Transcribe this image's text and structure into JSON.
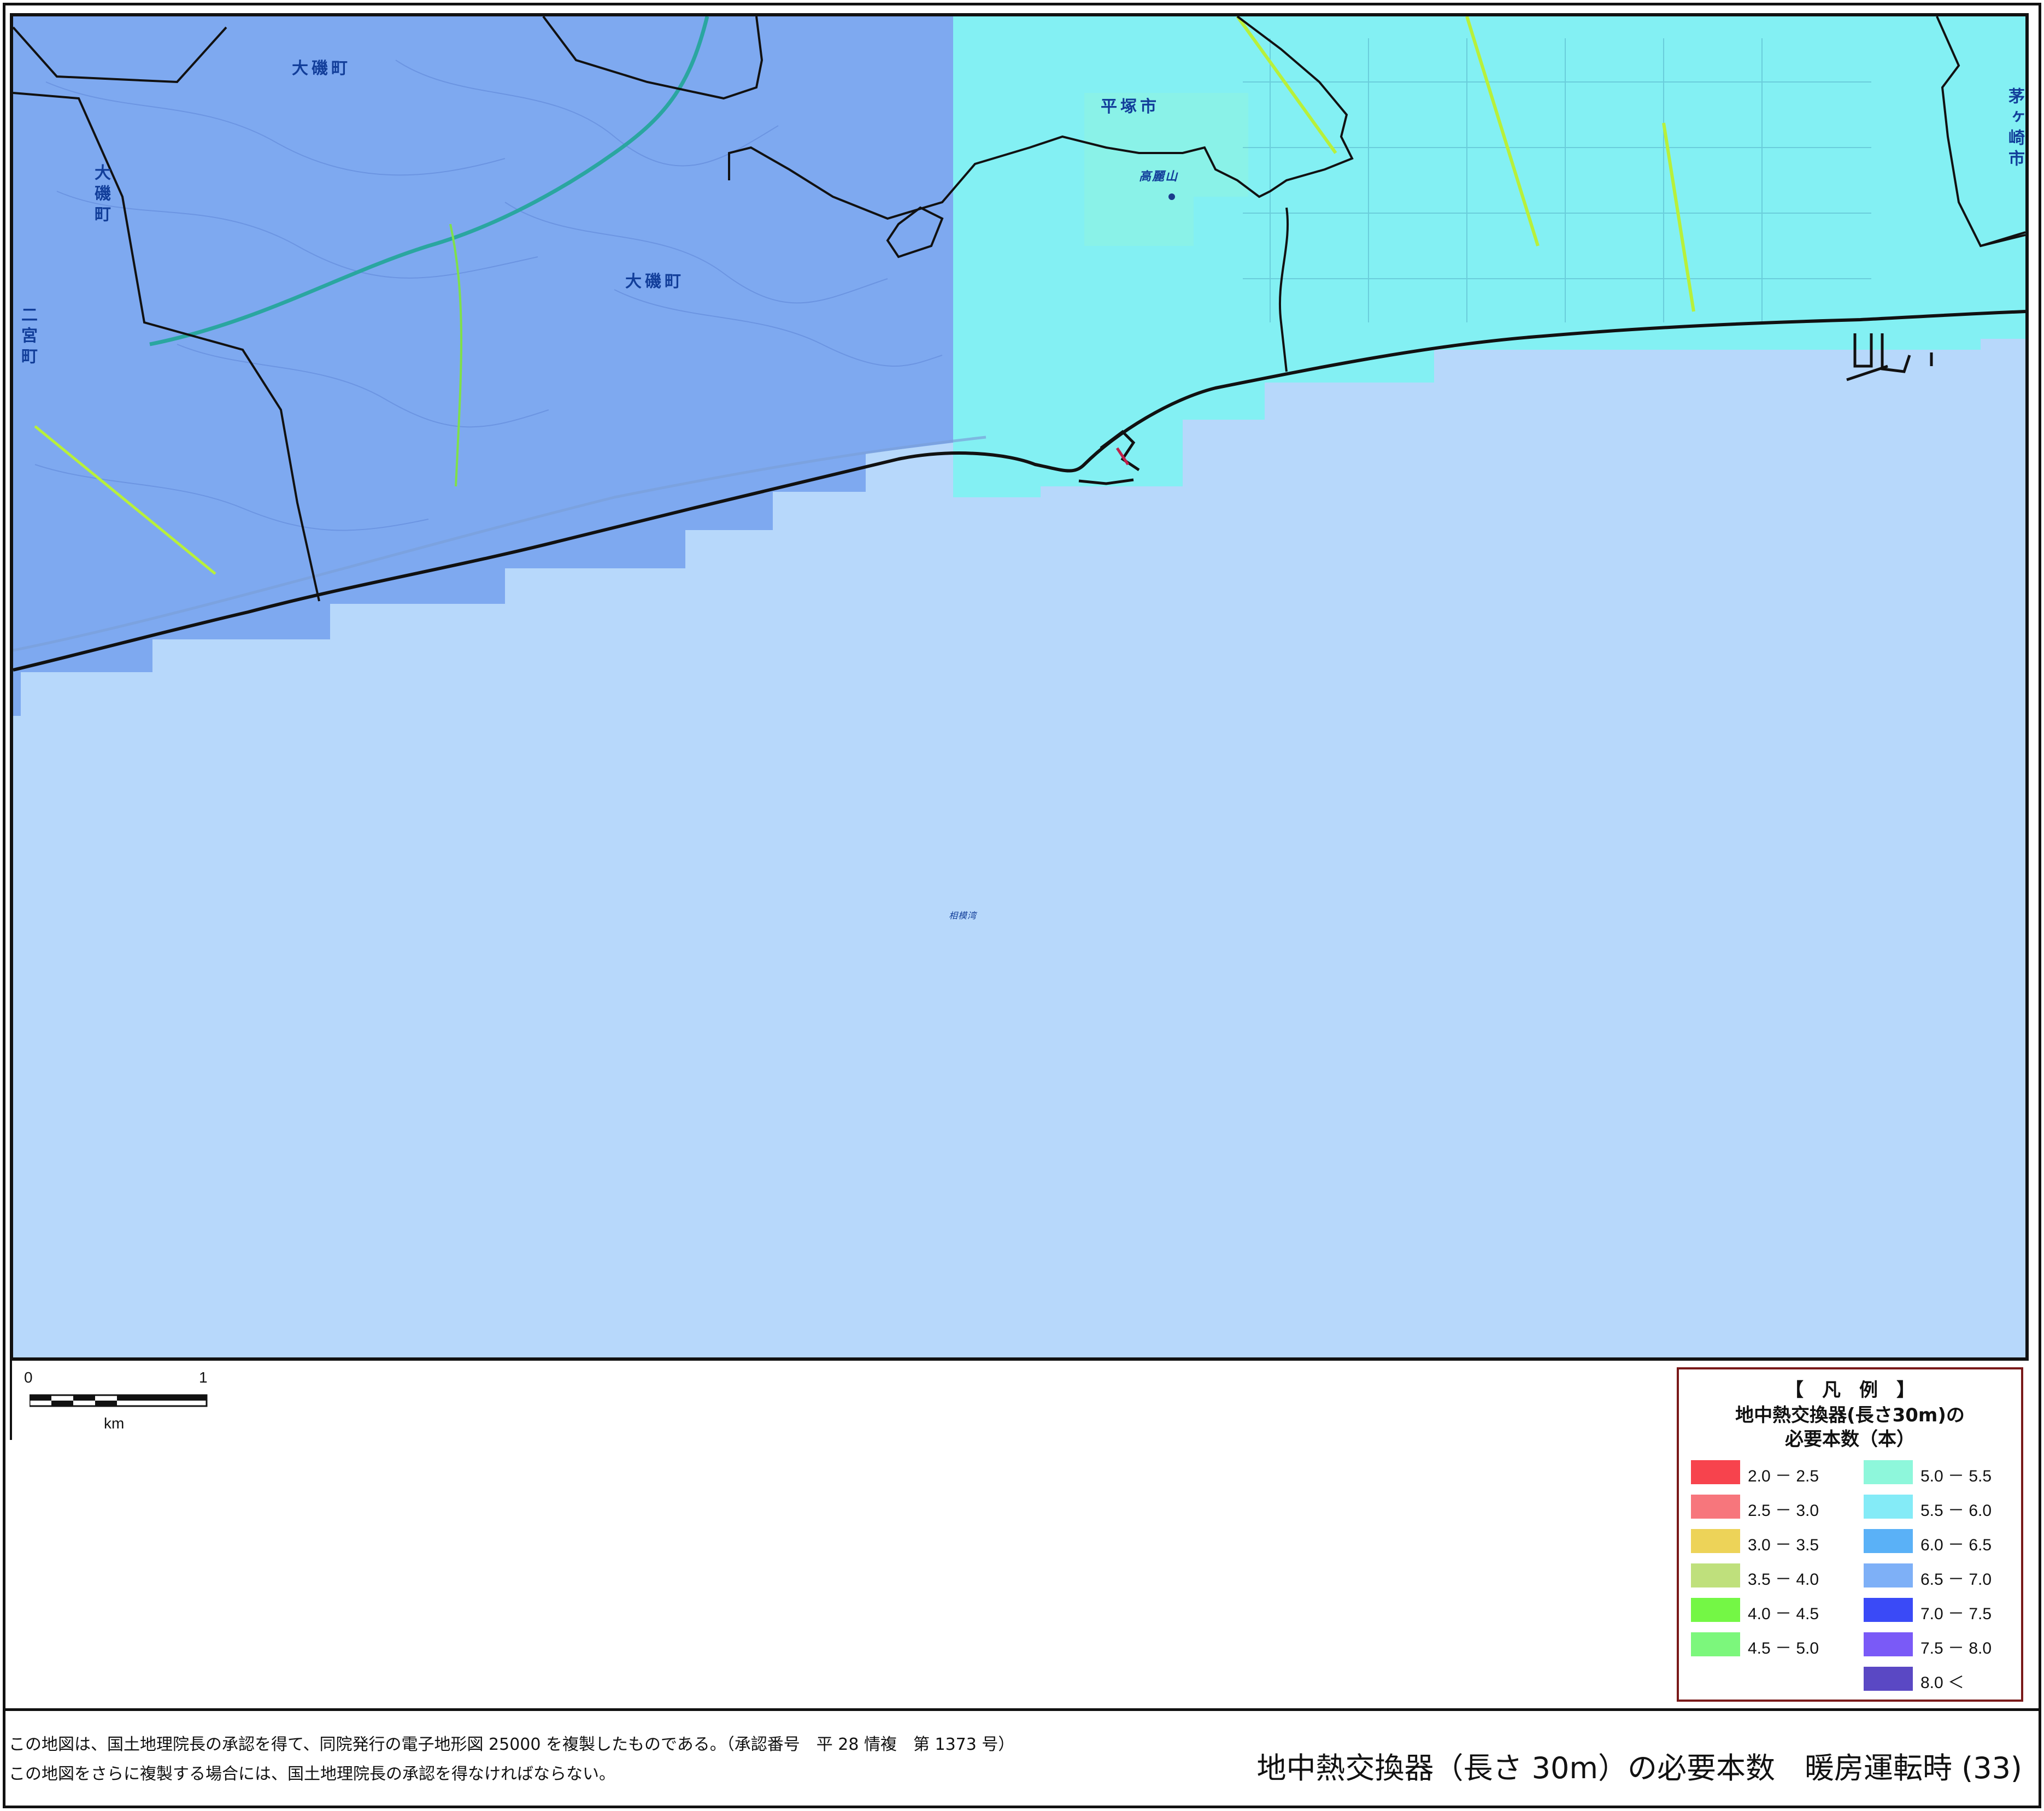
{
  "map": {
    "labels": {
      "oiso_top": "大磯町",
      "oiso_center": "大磯町",
      "oiso_vertical": "大磯町",
      "ninomiya": "二宮町",
      "hiratsuka": "平塚市",
      "chigasaki": "茅ヶ崎市",
      "takatoriyama": "高麗山",
      "sagami_bay": "相模湾"
    },
    "colors": {
      "sea": "#b7d8fb",
      "land_65_70": "#7ea9f0",
      "land_60_65": "#8fc0f7",
      "land_55_60": "#83f0f3",
      "boundary": "#111111",
      "road_highway": "#2aa6a0",
      "road_route": "#b8f03a"
    }
  },
  "scale": {
    "zero": "0",
    "one": "1",
    "unit": "km"
  },
  "legend": {
    "header": "【　凡　例　】",
    "title_line1": "地中熱交換器(長さ30m)の",
    "title_line2": "必要本数（本）",
    "items": [
      {
        "label": "2.0 － 2.5",
        "color": "#f7434d"
      },
      {
        "label": "2.5 － 3.0",
        "color": "#f7767c"
      },
      {
        "label": "3.0 － 3.5",
        "color": "#edd358"
      },
      {
        "label": "3.5 － 4.0",
        "color": "#bfe07c"
      },
      {
        "label": "4.0 － 4.5",
        "color": "#74f745"
      },
      {
        "label": "4.5 － 5.0",
        "color": "#7cf77c"
      },
      {
        "label": "5.0 － 5.5",
        "color": "#8ef7db"
      },
      {
        "label": "5.5 － 6.0",
        "color": "#84ebf7"
      },
      {
        "label": "6.0 － 6.5",
        "color": "#5ab1f7"
      },
      {
        "label": "6.5 － 7.0",
        "color": "#7eb0f7"
      },
      {
        "label": "7.0 － 7.5",
        "color": "#3a4af7"
      },
      {
        "label": "7.5 － 8.0",
        "color": "#7a5af7"
      },
      {
        "label": "8.0 ＜",
        "color": "#5a48c4"
      }
    ]
  },
  "footer": {
    "credit_line1": "この地図は、国土地理院長の承認を得て、同院発行の電子地形図 25000 を複製したものである。（承認番号　平 28 情複　第 1373 号）",
    "credit_line2": "この地図をさらに複製する場合には、国土地理院長の承認を得なければならない。",
    "title": "地中熱交換器（長さ 30m）の必要本数　暖房運転時 (33)"
  }
}
